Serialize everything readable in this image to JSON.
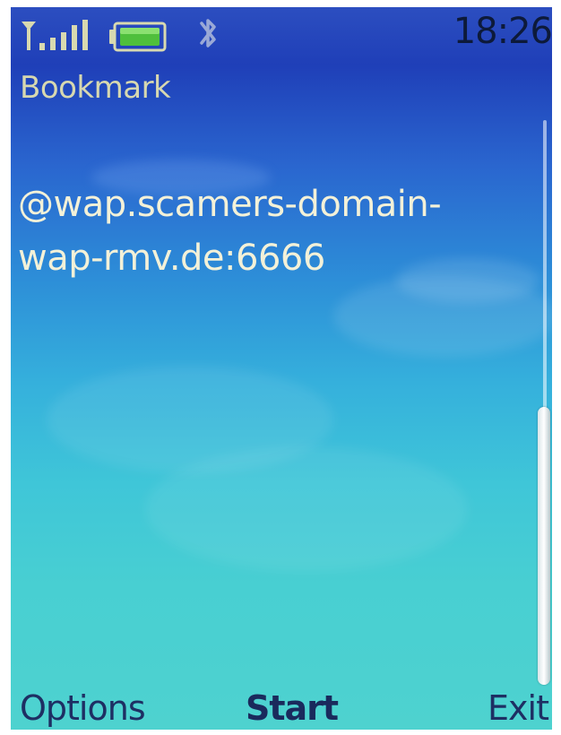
{
  "status": {
    "time": "18:26",
    "signal_icon": "signal-strength-icon",
    "battery_icon": "battery-icon",
    "bluetooth_icon": "bluetooth-icon"
  },
  "app": {
    "title": "Bookmark"
  },
  "bookmark": {
    "address": "@wap.scamers-domain-\nwap-rmv.de:6666"
  },
  "softkeys": {
    "left": "Options",
    "middle": "Start",
    "right": "Exit"
  },
  "colors": {
    "title_text": "#d7d8b0",
    "body_text": "#f3f1d8",
    "softkey_text": "#1e2f63"
  }
}
